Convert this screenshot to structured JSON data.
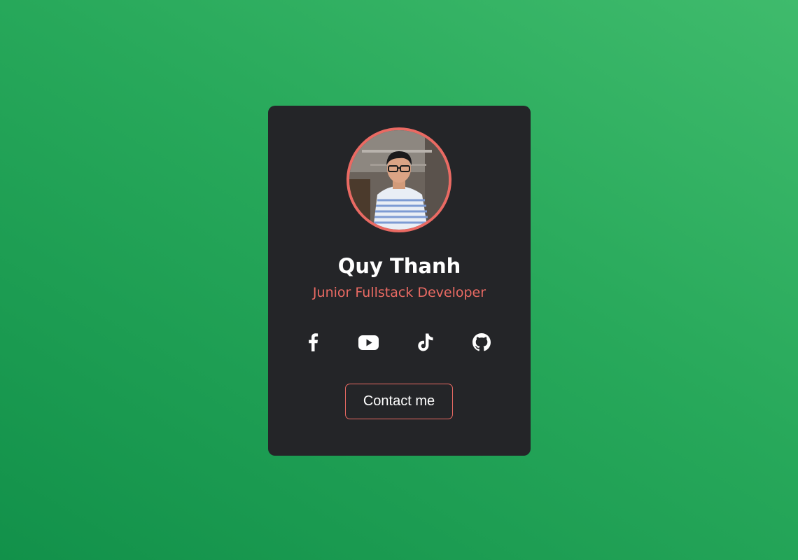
{
  "profile": {
    "name": "Quy Thanh",
    "role": "Junior Fullstack Developer",
    "avatar_icon": "profile-photo"
  },
  "social": [
    {
      "name": "facebook",
      "icon": "facebook-icon"
    },
    {
      "name": "youtube",
      "icon": "youtube-icon"
    },
    {
      "name": "tiktok",
      "icon": "tiktok-icon"
    },
    {
      "name": "github",
      "icon": "github-icon"
    }
  ],
  "contact": {
    "label": "Contact me"
  },
  "colors": {
    "background_start": "#12914a",
    "background_end": "#3fbb6c",
    "card": "#242528",
    "accent": "#ea6a63",
    "text": "#ffffff"
  }
}
